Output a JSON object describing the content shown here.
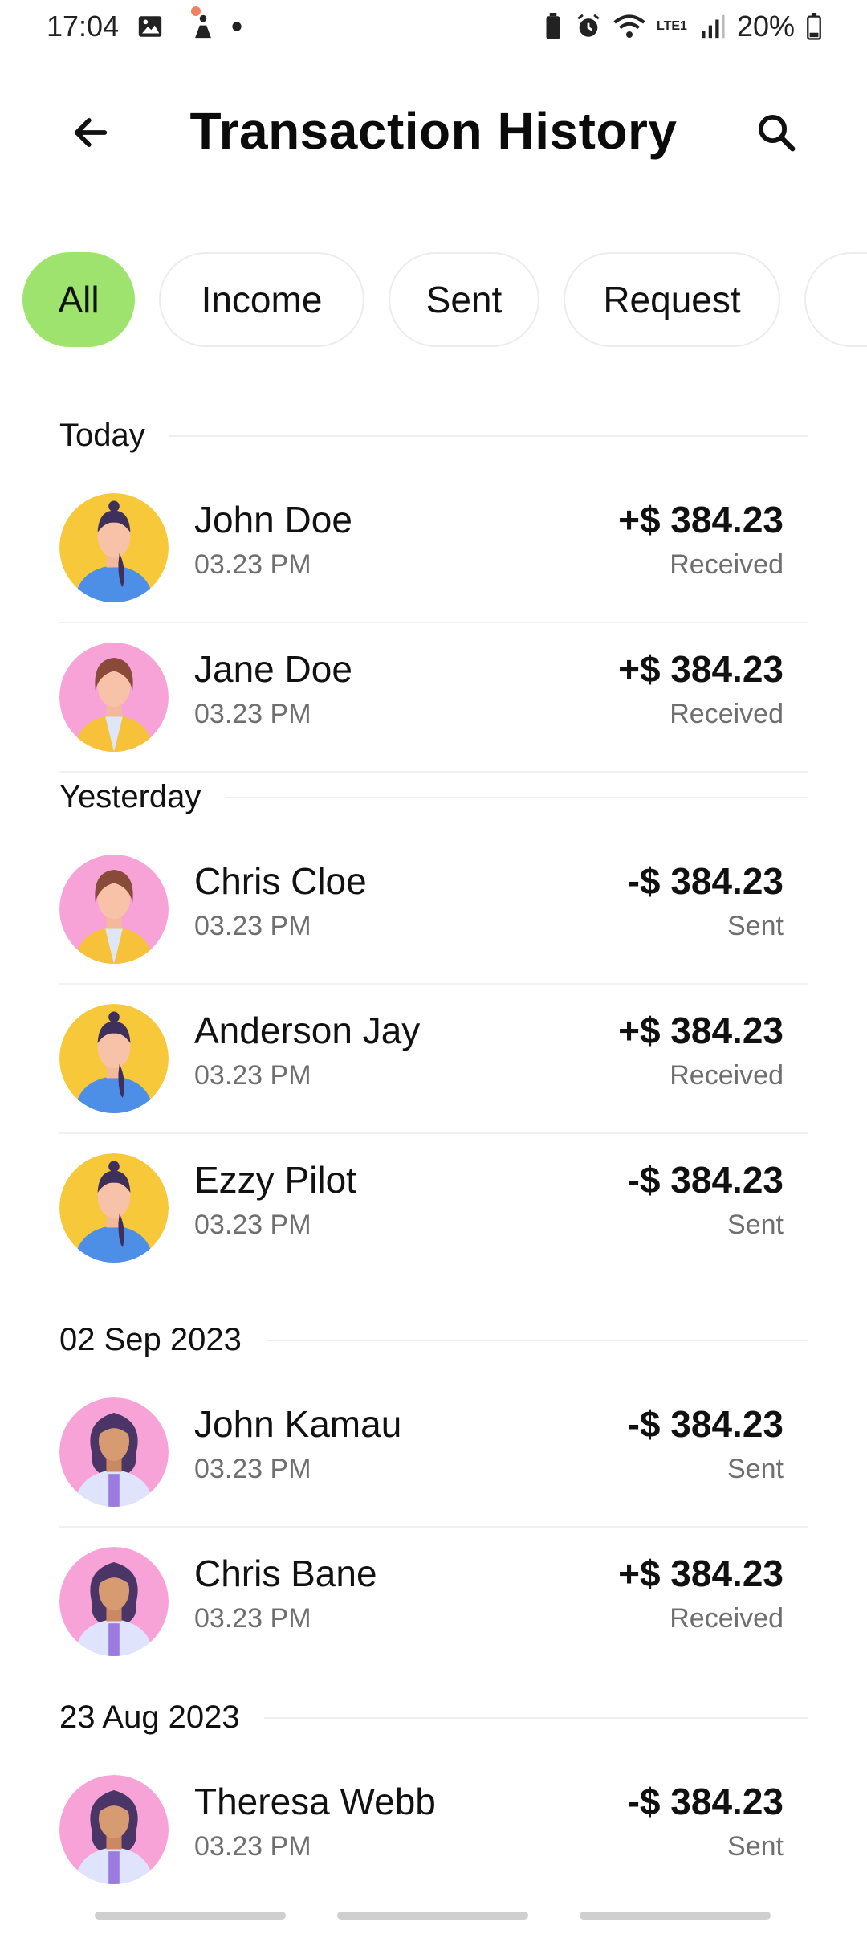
{
  "status_bar": {
    "time": "17:04",
    "battery": "20%",
    "network": "LTE1"
  },
  "header": {
    "title": "Transaction History",
    "back_icon": "arrow-left-icon",
    "search_icon": "search-icon"
  },
  "filters": [
    {
      "label": "All",
      "active": true
    },
    {
      "label": "Income",
      "active": false
    },
    {
      "label": "Sent",
      "active": false
    },
    {
      "label": "Request",
      "active": false
    }
  ],
  "colors": {
    "accent": "#9ee36e",
    "text": "#111111",
    "muted": "#6f6f6f"
  },
  "sections": [
    {
      "label": "Today",
      "items": [
        {
          "name": "John Doe",
          "time": "03.23 PM",
          "amount": "+$ 384.23",
          "status": "Received",
          "avatar": "yellow"
        },
        {
          "name": "Jane Doe",
          "time": "03.23 PM",
          "amount": "+$ 384.23",
          "status": "Received",
          "avatar": "pink"
        }
      ]
    },
    {
      "label": "Yesterday",
      "items": [
        {
          "name": "Chris Cloe",
          "time": "03.23 PM",
          "amount": "-$ 384.23",
          "status": "Sent",
          "avatar": "pink"
        },
        {
          "name": "Anderson Jay",
          "time": "03.23 PM",
          "amount": "+$ 384.23",
          "status": "Received",
          "avatar": "yellow"
        },
        {
          "name": "Ezzy Pilot",
          "time": "03.23 PM",
          "amount": "-$ 384.23",
          "status": "Sent",
          "avatar": "yellow"
        }
      ]
    },
    {
      "label": "02 Sep 2023",
      "items": [
        {
          "name": "John Kamau",
          "time": "03.23 PM",
          "amount": "-$ 384.23",
          "status": "Sent",
          "avatar": "violet"
        },
        {
          "name": "Chris Bane",
          "time": "03.23 PM",
          "amount": "+$ 384.23",
          "status": "Received",
          "avatar": "violet"
        }
      ]
    },
    {
      "label": "23 Aug 2023",
      "items": [
        {
          "name": "Theresa Webb",
          "time": "03.23 PM",
          "amount": "-$ 384.23",
          "status": "Sent",
          "avatar": "violet"
        }
      ]
    }
  ]
}
